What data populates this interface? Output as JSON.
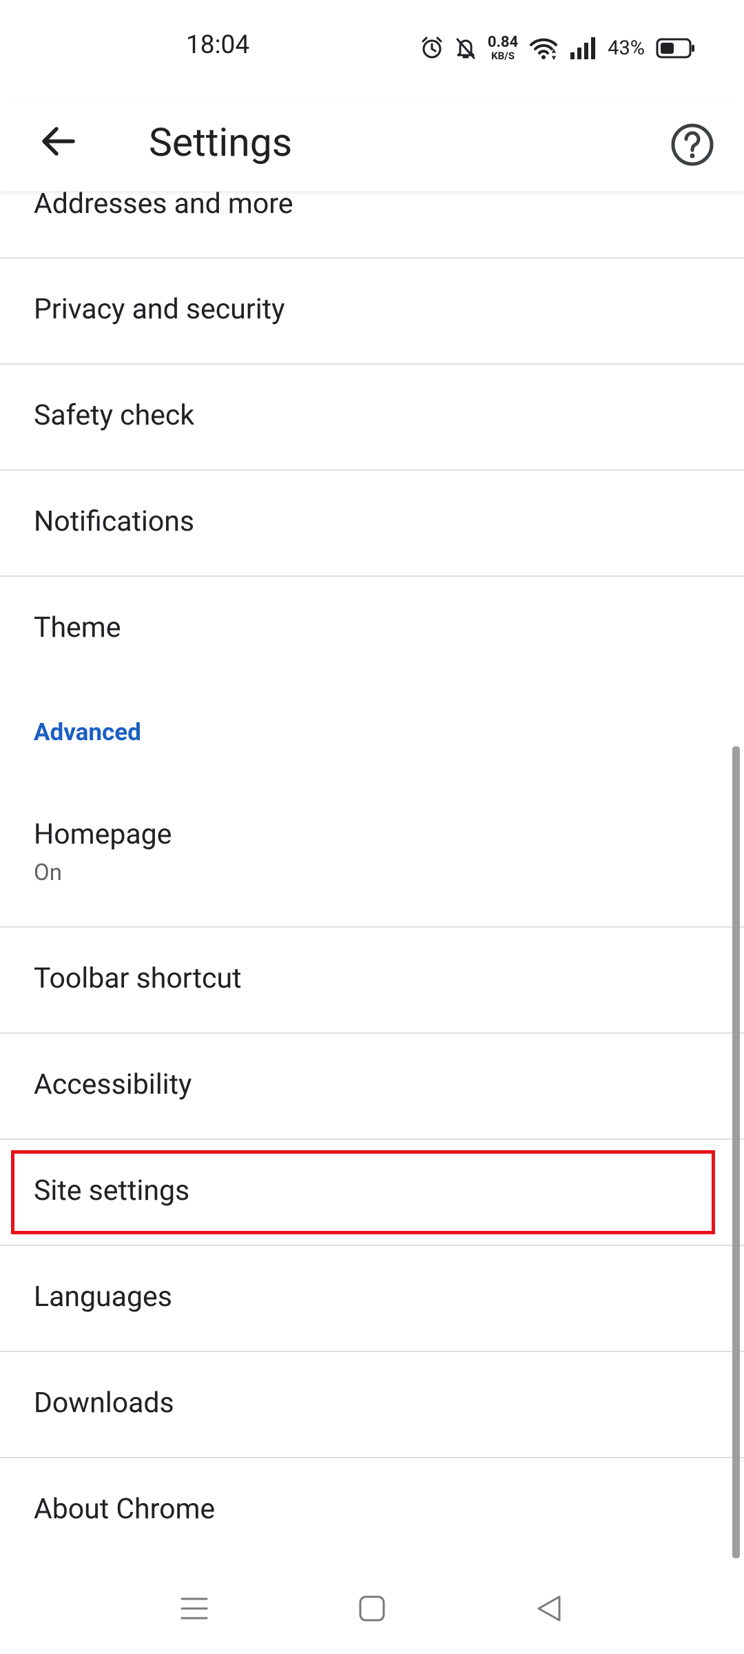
{
  "status_bar": {
    "time": "18:04",
    "net_speed_value": "0.84",
    "net_speed_unit": "KB/S",
    "battery_percent": "43%",
    "icons": [
      "alarm-icon",
      "bell-off-icon",
      "wifi-icon",
      "signal-icon",
      "battery-icon"
    ]
  },
  "app_bar": {
    "title": "Settings",
    "back_icon": "arrow-left-icon",
    "help_icon": "help-circle-icon"
  },
  "list": {
    "items_basic": [
      {
        "label": "Addresses and more"
      },
      {
        "label": "Privacy and security"
      },
      {
        "label": "Safety check"
      },
      {
        "label": "Notifications"
      },
      {
        "label": "Theme"
      }
    ],
    "section_header": "Advanced",
    "homepage": {
      "label": "Homepage",
      "sub": "On"
    },
    "items_advanced": [
      {
        "label": "Toolbar shortcut"
      },
      {
        "label": "Accessibility"
      },
      {
        "label": "Site settings"
      },
      {
        "label": "Languages"
      },
      {
        "label": "Downloads"
      },
      {
        "label": "About Chrome"
      }
    ]
  },
  "highlight": {
    "target": "Site settings",
    "color": "#e8121b"
  },
  "colors": {
    "accent": "#1a5fc4",
    "text": "#202124",
    "secondary_text": "#5f6368",
    "divider": "#dedede"
  },
  "nav_bar": {
    "icons": [
      "menu-lines-icon",
      "home-square-icon",
      "back-triangle-icon"
    ]
  }
}
